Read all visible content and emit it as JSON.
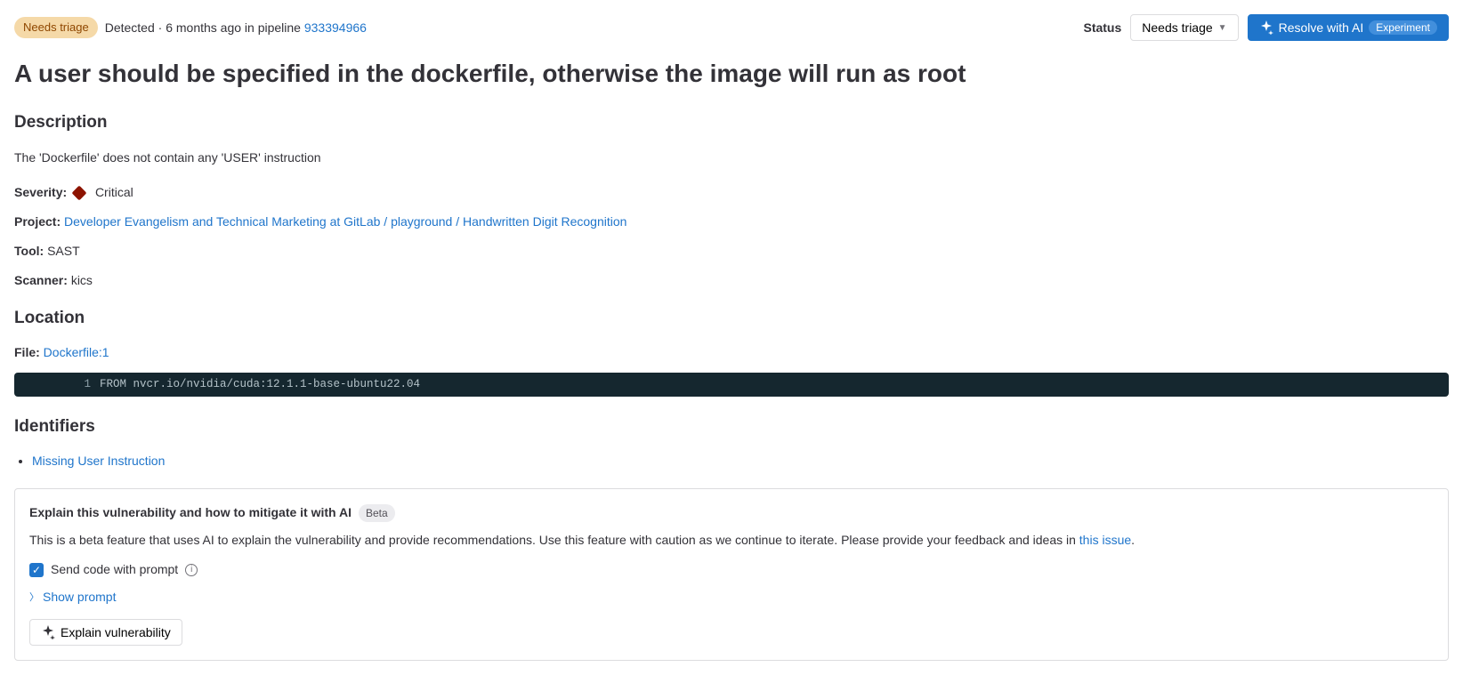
{
  "header": {
    "triage_badge": "Needs triage",
    "detected_prefix": "Detected · 6 months ago in pipeline ",
    "pipeline_id": "933394966",
    "status_label": "Status",
    "status_value": "Needs triage",
    "resolve_button": "Resolve with AI",
    "experiment_badge": "Experiment"
  },
  "title": "A user should be specified in the dockerfile, otherwise the image will run as root",
  "description": {
    "heading": "Description",
    "text": "The 'Dockerfile' does not contain any 'USER' instruction",
    "severity_label": "Severity:",
    "severity_value": "Critical",
    "project_label": "Project:",
    "project_link": "Developer Evangelism and Technical Marketing at GitLab / playground / Handwritten Digit Recognition",
    "tool_label": "Tool:",
    "tool_value": "SAST",
    "scanner_label": "Scanner:",
    "scanner_value": "kics"
  },
  "location": {
    "heading": "Location",
    "file_label": "File:",
    "file_link": "Dockerfile:1",
    "code_line_num": "1",
    "code_line": "FROM nvcr.io/nvidia/cuda:12.1.1-base-ubuntu22.04"
  },
  "identifiers": {
    "heading": "Identifiers",
    "items": [
      "Missing User Instruction"
    ]
  },
  "ai_panel": {
    "title": "Explain this vulnerability and how to mitigate it with AI",
    "beta_badge": "Beta",
    "description_before": "This is a beta feature that uses AI to explain the vulnerability and provide recommendations. Use this feature with caution as we continue to iterate. Please provide your feedback and ideas in ",
    "issue_link": "this issue",
    "period": ".",
    "checkbox_label": "Send code with prompt",
    "show_prompt": "Show prompt",
    "explain_button": "Explain vulnerability"
  }
}
